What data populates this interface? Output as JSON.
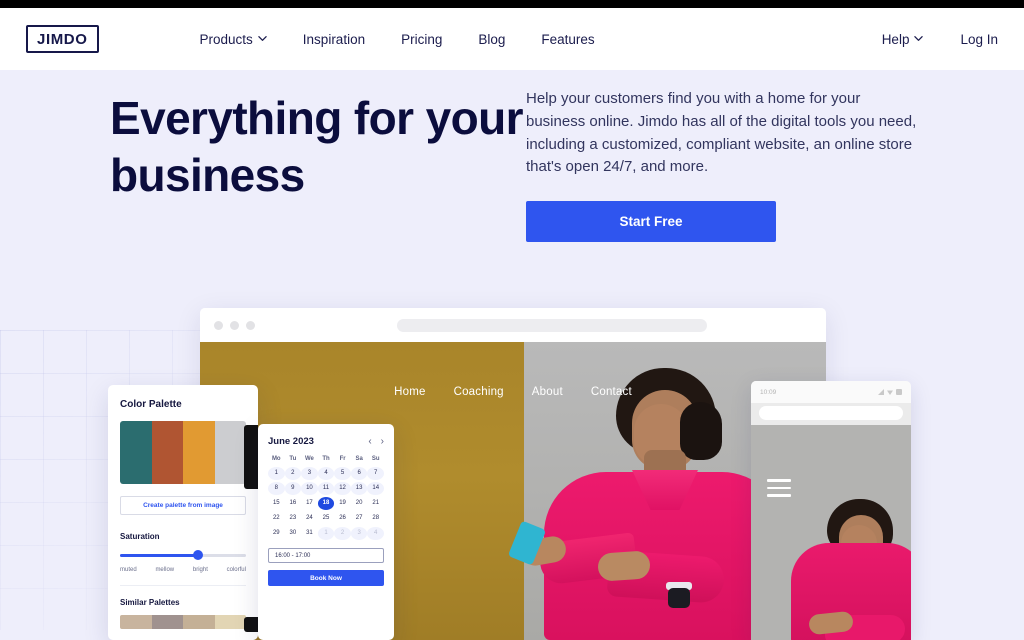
{
  "header": {
    "logo": "JIMDO",
    "nav": [
      {
        "label": "Products",
        "has_caret": true,
        "icon": "chevron-down-icon"
      },
      {
        "label": "Inspiration",
        "has_caret": false
      },
      {
        "label": "Pricing",
        "has_caret": false
      },
      {
        "label": "Blog",
        "has_caret": false
      },
      {
        "label": "Features",
        "has_caret": false
      }
    ],
    "right": [
      {
        "label": "Help",
        "has_caret": true,
        "icon": "chevron-down-icon"
      },
      {
        "label": "Log In",
        "has_caret": false
      }
    ]
  },
  "hero": {
    "title": "Everything for your business",
    "paragraph": "Help your customers find you with a home for your business online. Jimdo has all of the digital tools you need, including a customized, compliant website, an online store that's open 24/7, and more.",
    "cta_label": "Start Free",
    "accent_color": "#2f55ef",
    "background_color": "#eeeefb",
    "title_color": "#0b0d3d"
  },
  "browser_mockup": {
    "site_nav": [
      "Home",
      "Coaching",
      "About",
      "Contact"
    ]
  },
  "phone_mockup": {
    "time": "10:09"
  },
  "palette_card": {
    "title": "Color Palette",
    "swatches": [
      "#2b6d6f",
      "#b05532",
      "#e19a32",
      "#cccdd0"
    ],
    "button_label": "Create palette from image",
    "slider_title": "Saturation",
    "slider_labels": [
      "muted",
      "mellow",
      "bright",
      "colorful"
    ],
    "slider_value": 62,
    "similar_title": "Similar Palettes",
    "similar_swatches": [
      "#c8b49e",
      "#a0928f",
      "#c4b096",
      "#e2d5b4"
    ]
  },
  "calendar_card": {
    "month": "June 2023",
    "prev_icon": "chevron-left-icon",
    "next_icon": "chevron-right-icon",
    "dow": [
      "Mo",
      "Tu",
      "We",
      "Th",
      "Fr",
      "Sa",
      "Su"
    ],
    "weeks": [
      [
        {
          "d": "1",
          "s": "pill"
        },
        {
          "d": "2",
          "s": "pill"
        },
        {
          "d": "3",
          "s": "pill"
        },
        {
          "d": "4",
          "s": "pill"
        },
        {
          "d": "5",
          "s": "pill"
        },
        {
          "d": "6",
          "s": "pill"
        },
        {
          "d": "7",
          "s": "pill"
        }
      ],
      [
        {
          "d": "8",
          "s": "pill"
        },
        {
          "d": "9",
          "s": "pill"
        },
        {
          "d": "10",
          "s": "pill"
        },
        {
          "d": "11",
          "s": "pill"
        },
        {
          "d": "12",
          "s": "pill"
        },
        {
          "d": "13",
          "s": "pill"
        },
        {
          "d": "14",
          "s": "pill"
        }
      ],
      [
        {
          "d": "15",
          "s": ""
        },
        {
          "d": "16",
          "s": ""
        },
        {
          "d": "17",
          "s": ""
        },
        {
          "d": "18",
          "s": "sel"
        },
        {
          "d": "19",
          "s": ""
        },
        {
          "d": "20",
          "s": ""
        },
        {
          "d": "21",
          "s": ""
        }
      ],
      [
        {
          "d": "22",
          "s": ""
        },
        {
          "d": "23",
          "s": ""
        },
        {
          "d": "24",
          "s": ""
        },
        {
          "d": "25",
          "s": ""
        },
        {
          "d": "26",
          "s": ""
        },
        {
          "d": "27",
          "s": ""
        },
        {
          "d": "28",
          "s": ""
        }
      ],
      [
        {
          "d": "29",
          "s": ""
        },
        {
          "d": "30",
          "s": ""
        },
        {
          "d": "31",
          "s": ""
        },
        {
          "d": "1",
          "s": "pill muted"
        },
        {
          "d": "2",
          "s": "pill muted"
        },
        {
          "d": "3",
          "s": "pill muted"
        },
        {
          "d": "4",
          "s": "pill muted"
        }
      ]
    ],
    "selected_day": "18",
    "time_value": "16:00 - 17:00",
    "book_label": "Book Now"
  }
}
